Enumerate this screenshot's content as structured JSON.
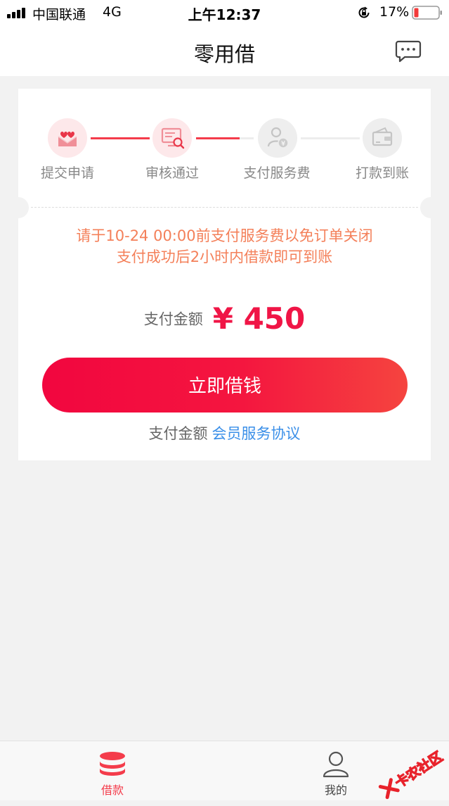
{
  "status_bar": {
    "carrier": "中国联通",
    "network": "4G",
    "time": "上午12:37",
    "battery": "17%"
  },
  "nav": {
    "title": "零用借",
    "right_icon": "message-icon"
  },
  "steps": [
    {
      "label": "提交申请",
      "icon": "envelope-hearts-icon",
      "active": true
    },
    {
      "label": "审核通过",
      "icon": "screen-search-icon",
      "active": true
    },
    {
      "label": "支付服务费",
      "icon": "user-yen-icon",
      "active": false
    },
    {
      "label": "打款到账",
      "icon": "wallet-icon",
      "active": false
    }
  ],
  "notice": {
    "line1": "请于10-24 00:00前支付服务费以免订单关闭",
    "line2": "支付成功后2小时内借款即可到账"
  },
  "payment": {
    "label": "支付金额",
    "amount": "¥ 450"
  },
  "button": {
    "label": "立即借钱"
  },
  "agreement": {
    "prefix": "支付金额",
    "link": "会员服务协议"
  },
  "tabs": [
    {
      "label": "借款",
      "icon": "coins-stack-icon",
      "active": true
    },
    {
      "label": "我的",
      "icon": "person-icon",
      "active": false
    }
  ],
  "watermark": {
    "text": "卡农社区"
  },
  "colors": {
    "accent_red": "#f43c4b",
    "amount_red": "#f01546",
    "notice_orange": "#f4805a",
    "link_blue": "#3a8fe8"
  }
}
